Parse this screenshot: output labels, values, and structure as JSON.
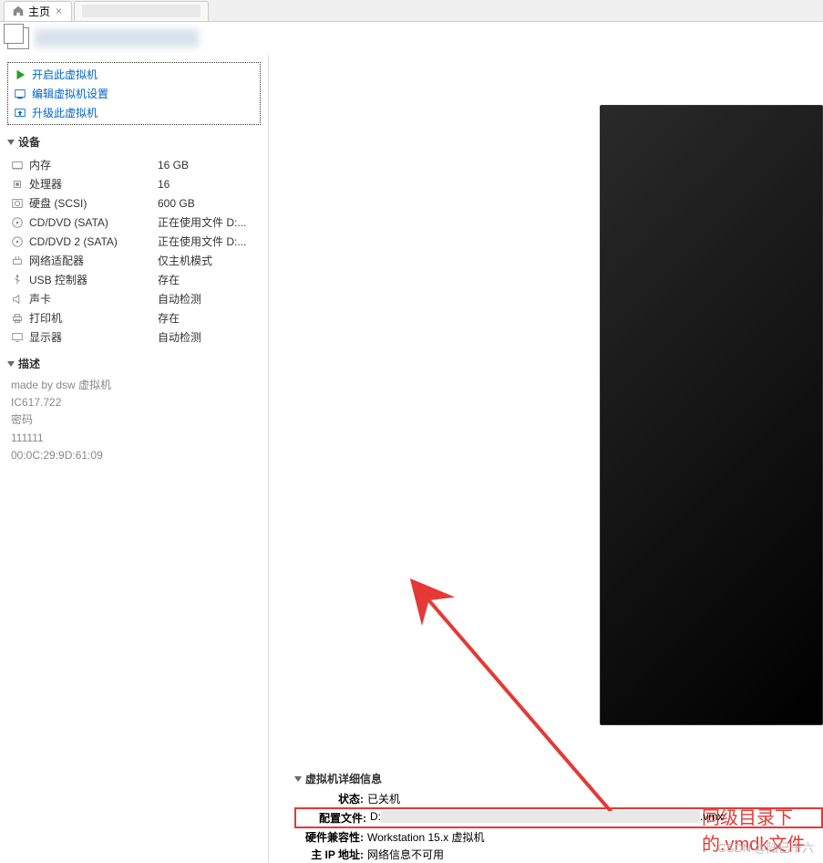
{
  "tabs": {
    "home": "主页",
    "second": "████████"
  },
  "title": "████████",
  "actions": {
    "power_on": "开启此虚拟机",
    "edit_settings": "编辑虚拟机设置",
    "upgrade": "升级此虚拟机"
  },
  "sections": {
    "devices": "设备",
    "description": "描述"
  },
  "devices": [
    {
      "label": "内存",
      "value": "16 GB",
      "icon": "memory"
    },
    {
      "label": "处理器",
      "value": "16",
      "icon": "cpu"
    },
    {
      "label": "硬盘 (SCSI)",
      "value": "600 GB",
      "icon": "disk"
    },
    {
      "label": "CD/DVD (SATA)",
      "value": "正在使用文件 D:...",
      "icon": "cd"
    },
    {
      "label": "CD/DVD 2 (SATA)",
      "value": "正在使用文件 D:...",
      "icon": "cd"
    },
    {
      "label": "网络适配器",
      "value": "仅主机模式",
      "icon": "network"
    },
    {
      "label": "USB 控制器",
      "value": "存在",
      "icon": "usb"
    },
    {
      "label": "声卡",
      "value": "自动检测",
      "icon": "sound"
    },
    {
      "label": "打印机",
      "value": "存在",
      "icon": "printer"
    },
    {
      "label": "显示器",
      "value": "自动检测",
      "icon": "display"
    }
  ],
  "description": {
    "line1": "made by dsw 虚拟机",
    "line2": "IC617.722",
    "line3": "密码",
    "line4": "111111",
    "line5": "00:0C:29:9D:61:09"
  },
  "details": {
    "header": "虚拟机详细信息",
    "status_label": "状态:",
    "status_value": "已关机",
    "config_label": "配置文件:",
    "config_prefix": "D:",
    "config_suffix": ".vmx",
    "compat_label": "硬件兼容性:",
    "compat_value": "Workstation 15.x 虚拟机",
    "ip_label": "主 IP 地址:",
    "ip_value": "网络信息不可用"
  },
  "annotation": "同级目录下的.vmdk文件",
  "watermark": "CSDN @陆已十六"
}
